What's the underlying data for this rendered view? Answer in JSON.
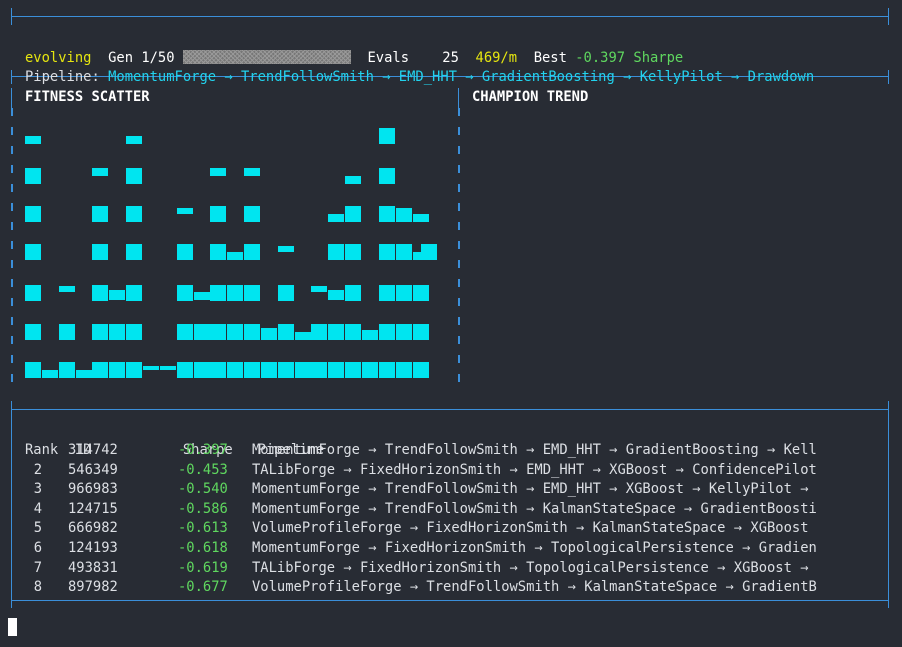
{
  "status": {
    "state": "evolving",
    "gen_label": "Gen",
    "gen_value": "1/50",
    "evals_label": "Evals",
    "evals_value": "25",
    "rate": "469/m",
    "best_label": "Best",
    "best_value": "-0.397",
    "best_unit": "Sharpe",
    "progress_fraction": 0.02
  },
  "pipeline": {
    "label": "Pipeline:",
    "value": "MomentumForge → TrendFollowSmith → EMD_HHT → GradientBoosting → KellyPilot → Drawdown"
  },
  "panels": {
    "scatter_title": "FITNESS SCATTER",
    "trend_title": "CHAMPION TREND"
  },
  "table": {
    "headers": {
      "rank": "Rank",
      "id": "ID",
      "sharpe": "Sharpe",
      "pipeline": "Pipeline"
    },
    "rows": [
      {
        "rank": "",
        "id": "314742",
        "sharpe": "-0.397",
        "pipeline": "MomentumForge → TrendFollowSmith → EMD_HHT → GradientBoosting → Kell"
      },
      {
        "rank": "2",
        "id": "546349",
        "sharpe": "-0.453",
        "pipeline": "TALibForge → FixedHorizonSmith → EMD_HHT → XGBoost → ConfidencePilot"
      },
      {
        "rank": "3",
        "id": "966983",
        "sharpe": "-0.540",
        "pipeline": "MomentumForge → TrendFollowSmith → EMD_HHT → XGBoost → KellyPilot →"
      },
      {
        "rank": "4",
        "id": "124715",
        "sharpe": "-0.586",
        "pipeline": "MomentumForge → TrendFollowSmith → KalmanStateSpace → GradientBoosti"
      },
      {
        "rank": "5",
        "id": "666982",
        "sharpe": "-0.613",
        "pipeline": "VolumeProfileForge → FixedHorizonSmith → KalmanStateSpace → XGBoost"
      },
      {
        "rank": "6",
        "id": "124193",
        "sharpe": "-0.618",
        "pipeline": "MomentumForge → FixedHorizonSmith → TopologicalPersistence → Gradien"
      },
      {
        "rank": "7",
        "id": "493831",
        "sharpe": "-0.619",
        "pipeline": "TALibForge → FixedHorizonSmith → TopologicalPersistence → XGBoost →"
      },
      {
        "rank": "8",
        "id": "897982",
        "sharpe": "-0.677",
        "pipeline": "VolumeProfileForge → TrendFollowSmith → KalmanStateSpace → GradientB"
      }
    ]
  }
}
